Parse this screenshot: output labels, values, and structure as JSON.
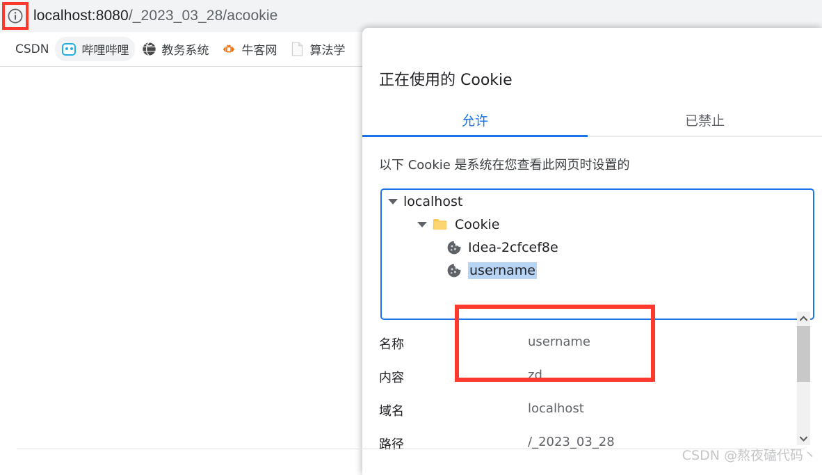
{
  "browser": {
    "url": "localhost:8080/_2023_03_28/acookie",
    "url_host": "localhost:8080",
    "url_path": "/_2023_03_28/acookie",
    "site_info_icon": "info-circle-icon",
    "highlight_color": "#fd3a2d",
    "bookmarks": [
      {
        "label": "CSDN",
        "icon": "csdn-icon"
      },
      {
        "label": "哔哩哔哩",
        "icon": "bilibili-tv-icon"
      },
      {
        "label": "教务系统",
        "icon": "globe-icon"
      },
      {
        "label": "牛客网",
        "icon": "nowcoder-icon"
      },
      {
        "label": "算法学",
        "icon": "document-icon"
      }
    ]
  },
  "dialog": {
    "title": "正在使用的 Cookie",
    "tabs": [
      {
        "label": "允许",
        "active": true
      },
      {
        "label": "已禁止",
        "active": false
      }
    ],
    "subtitle": "以下 Cookie 是系统在您查看此网页时设置的",
    "accent_color": "#1a73e8",
    "tree": {
      "host": "localhost",
      "folder": "Cookie",
      "cookies": [
        {
          "name": "Idea-2cfcef8e",
          "selected": false
        },
        {
          "name": "username",
          "selected": true
        }
      ]
    },
    "details": [
      {
        "label": "名称",
        "value": "username"
      },
      {
        "label": "内容",
        "value": "zd"
      },
      {
        "label": "域名",
        "value": "localhost"
      },
      {
        "label": "路径",
        "value": "/_2023_03_28"
      }
    ],
    "scrollbar": {
      "up_icon": "chevron-up-icon",
      "down_icon": "chevron-down-icon"
    }
  },
  "watermark": "CSDN @熬夜磕代码丶"
}
